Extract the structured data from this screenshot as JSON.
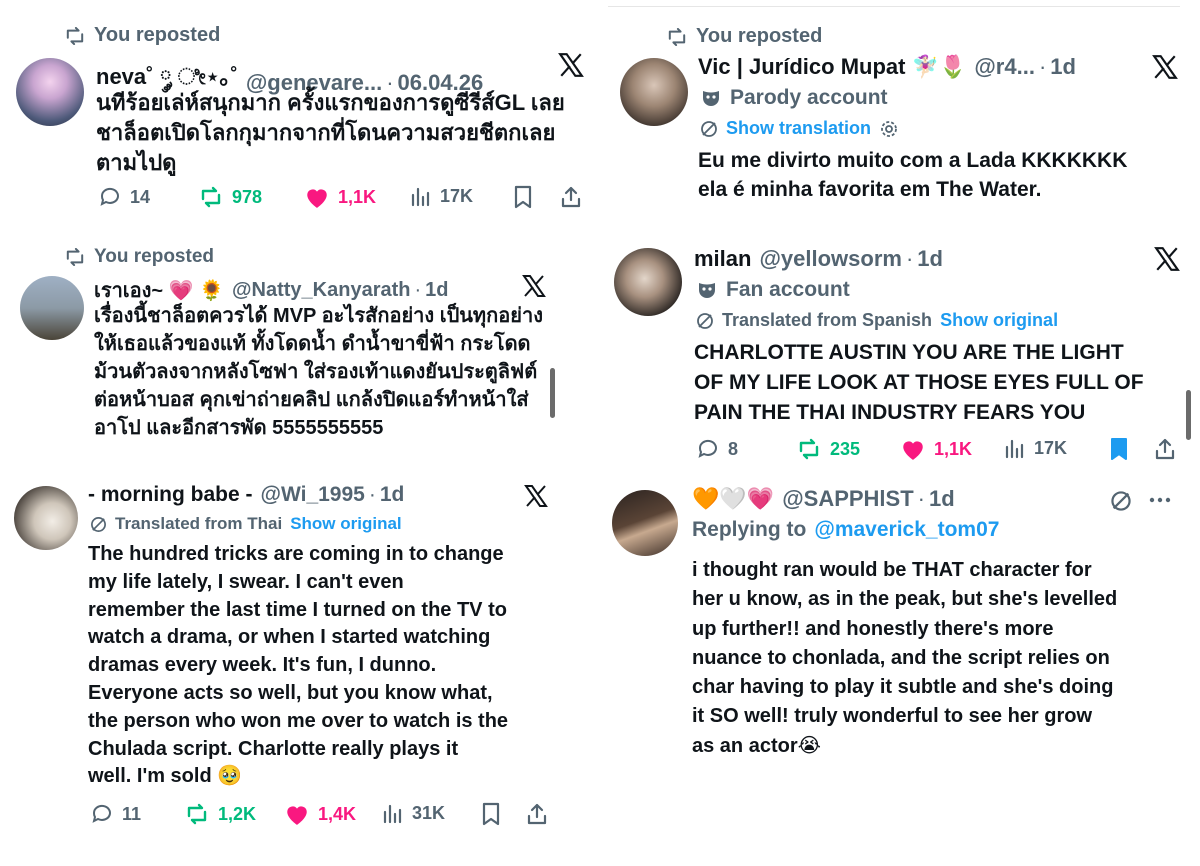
{
  "tweets": {
    "t1": {
      "repost_label": "You reposted",
      "name": "neva˚ ༘ ೀ⋆｡˚",
      "handle": "@genevare...",
      "date": "06.04.26",
      "text_lines": [
        "นทีร้อยเล่ห์สนุกมาก ครั้งแรกของการดูซีรีส์GL เลย",
        "ชาล็อตเปิดโลกกุมากจากที่โดนความสวยชีตกเลย",
        "ตามไปดู"
      ],
      "replies": "14",
      "reposts": "978",
      "likes": "1,1K",
      "views": "17K"
    },
    "t2": {
      "repost_label": "You reposted",
      "name": "Vic | Jurídico Mupat 🧚🏻‍♀️🌷",
      "handle": "@r4...",
      "date": "1d",
      "label": "Parody account",
      "show_translation": "Show translation",
      "text_lines": [
        "Eu me divirto muito com a Lada KKKKKKK",
        "ela é minha favorita em The Water."
      ]
    },
    "t3": {
      "repost_label": "You reposted",
      "name": "เราเอง~ 💗 🌻",
      "handle": "@Natty_Kanyarath",
      "date": "1d",
      "text_lines": [
        "เรื่องนี้ชาล็อตควรได้ MVP อะไรสักอย่าง เป็นทุกอย่าง",
        "ให้เธอแล้วของแท้ ทั้งโดดน้ำ ดำน้ำขาขี่ฟ้า กระโดด",
        "ม้วนตัวลงจากหลังโซฟา ใส่รองเท้าแดงยันประตูลิฟต์",
        "ต่อหน้าบอส คุกเข่าถ่ายคลิป แกล้งปิดแอร์ทำหน้าใส่",
        "อาโป และอีกสารพัด 5555555555"
      ]
    },
    "t4": {
      "name": "milan",
      "handle": "@yellowsorm",
      "date": "1d",
      "label": "Fan account",
      "translated": "Translated from Spanish",
      "show_original": "Show original",
      "text_lines": [
        "CHARLOTTE AUSTIN YOU ARE THE LIGHT",
        "OF MY LIFE LOOK AT THOSE EYES FULL OF",
        "PAIN THE THAI INDUSTRY FEARS YOU"
      ],
      "replies": "8",
      "reposts": "235",
      "likes": "1,1K",
      "views": "17K"
    },
    "t5": {
      "name": "- morning babe -",
      "handle": "@Wi_1995",
      "date": "1d",
      "translated": "Translated from Thai",
      "show_original": "Show original",
      "text_lines": [
        "The hundred tricks are coming in to change",
        "my life lately, I swear. I can't even",
        "remember the last time I turned on the TV to",
        "watch a drama, or when I started watching",
        "dramas every week. It's fun, I dunno.",
        "Everyone acts so well, but you know what,",
        "the person who won me over to watch is the",
        "Chulada script. Charlotte really plays it",
        "well. I'm sold 🥹"
      ],
      "replies": "11",
      "reposts": "1,2K",
      "likes": "1,4K",
      "views": "31K"
    },
    "t6": {
      "name": "🧡🤍💗",
      "handle": "@SAPPHlST",
      "date": "1d",
      "replying_prefix": "Replying to",
      "replying_to": "@maverick_tom07",
      "text_lines": [
        "i thought ran would be THAT character for",
        "her u know, as in the peak, but she's levelled",
        "up further!! and honestly there's more",
        "nuance to chonlada, and the script relies on",
        "char having to play it subtle and she's doing",
        "it SO well! truly wonderful to see her grow",
        "as an actor😭"
      ]
    }
  },
  "colors": {
    "text": "#0f1419",
    "muted": "#536471",
    "link": "#1d9bf0",
    "repost_green": "#00ba7c",
    "like_pink": "#f91880"
  },
  "icons": [
    "repost-icon",
    "reply-icon",
    "heart-icon",
    "views-icon",
    "bookmark-icon",
    "share-icon",
    "x-logo-icon",
    "mask-icon",
    "globe-icon",
    "gear-icon",
    "more-icon"
  ]
}
